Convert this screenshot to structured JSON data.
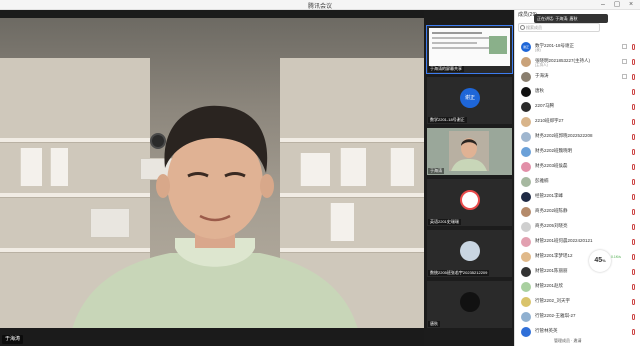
{
  "window": {
    "title": "腾讯会议"
  },
  "stage": {
    "speaker_label": "于海涛"
  },
  "thumbs": [
    {
      "label": "于海涛的屏幕共享",
      "kind": "screen"
    },
    {
      "label": "数学2201-18号谢正",
      "kind": "avatar",
      "avatar_text": "谢正",
      "color": "#1e66d8"
    },
    {
      "label": "于海涛",
      "kind": "video"
    },
    {
      "label": "英语2201史瑞瑞",
      "kind": "avatar",
      "color": "#e84a4a"
    },
    {
      "label": "数统2205班张若宇20235212209",
      "kind": "avatar",
      "color": "#9ab0c7"
    },
    {
      "label": "唐秋",
      "kind": "avatar",
      "color": "#111111"
    }
  ],
  "panel": {
    "header": "成员(29)",
    "search_placeholder": "搜索成员",
    "toast": "正在讲话: 于海涛; 唐秋",
    "members": [
      {
        "name": "数学2201-18号谢正",
        "sub": "(我)",
        "color": "#1e66d8",
        "avatar_text": "谢正"
      },
      {
        "name": "张晓明2021853227(主持人)",
        "sub": "(主持人)",
        "color": "#c9a27a"
      },
      {
        "name": "于海涛",
        "sub": "",
        "color": "#8a7f6f"
      },
      {
        "name": "唐秋",
        "sub": "",
        "color": "#111111"
      },
      {
        "name": "2207马腾",
        "sub": "",
        "color": "#2b2b2b"
      },
      {
        "name": "2210班郑宇27",
        "sub": "",
        "color": "#d8b48a"
      },
      {
        "name": "财务2202班郭晓2022522208",
        "sub": "",
        "color": "#9fb6cf"
      },
      {
        "name": "财务2202班魏晓明",
        "sub": "",
        "color": "#6aa0d8"
      },
      {
        "name": "财务2203班侯磊",
        "sub": "",
        "color": "#e28fa8"
      },
      {
        "name": "彭雅楠",
        "sub": "",
        "color": "#a6b8a0"
      },
      {
        "name": "经管2201李峰",
        "sub": "",
        "color": "#1f2a44"
      },
      {
        "name": "商务2202班陈静",
        "sub": "",
        "color": "#b48a6a"
      },
      {
        "name": "商务2205刘晓亮",
        "sub": "",
        "color": "#cfcfcf"
      },
      {
        "name": "财管2201班何晨2022420121",
        "sub": "",
        "color": "#e2a0b0"
      },
      {
        "name": "财管2201李梦瑶12",
        "sub": "",
        "color": "#e0b98a"
      },
      {
        "name": "财管2201陈丽丽",
        "sub": "",
        "color": "#333333"
      },
      {
        "name": "财管2201赵欣",
        "sub": "",
        "color": "#a9d0a0"
      },
      {
        "name": "行管2202_刘天宇",
        "sub": "",
        "color": "#d9c36a"
      },
      {
        "name": "行管2202-王雅琪-27",
        "sub": "",
        "color": "#8fb0d0"
      },
      {
        "name": "行管林英英",
        "sub": "",
        "color": "#2f6fd8"
      }
    ],
    "gauge_value": "45",
    "gauge_unit": "%",
    "gauge_caption": "0.1K/s",
    "footer": "管理成员 · 邀请"
  }
}
